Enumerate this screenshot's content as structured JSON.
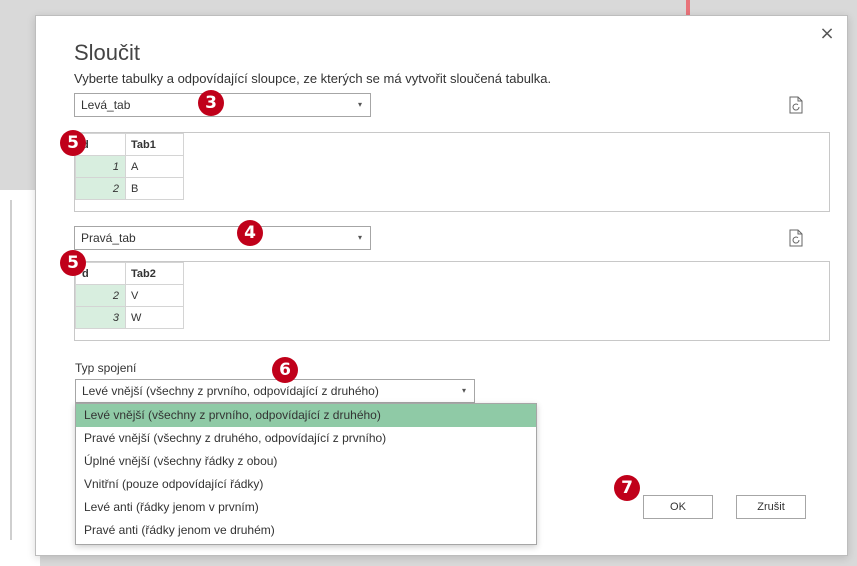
{
  "dialog": {
    "title": "Sloučit",
    "subtitle": "Vyberte tabulky a odpovídající sloupce, ze kterých se má vytvořit sloučená tabulka.",
    "close_icon": "×"
  },
  "left_table": {
    "select_value": "Levá_tab",
    "header": [
      "d",
      "Tab1"
    ],
    "rows": [
      {
        "idx": "1",
        "val": "A"
      },
      {
        "idx": "2",
        "val": "B"
      }
    ]
  },
  "right_table": {
    "select_value": "Pravá_tab",
    "header": [
      "d",
      "Tab2"
    ],
    "rows": [
      {
        "idx": "2",
        "val": "V"
      },
      {
        "idx": "3",
        "val": "W"
      }
    ]
  },
  "join": {
    "label": "Typ spojení",
    "selected": "Levé vnější (všechny z prvního, odpovídající z druhého)",
    "options": [
      "Levé vnější (všechny z prvního, odpovídající z druhého)",
      "Pravé vnější (všechny z druhého, odpovídající z prvního)",
      "Úplné vnější (všechny řádky z obou)",
      "Vnitřní (pouze odpovídající řádky)",
      "Levé anti (řádky jenom v prvním)",
      "Pravé anti (řádky jenom ve druhém)"
    ]
  },
  "buttons": {
    "ok": "OK",
    "cancel": "Zrušit"
  },
  "badges": {
    "b3": "3",
    "b4": "4",
    "b5a": "5",
    "b5b": "5",
    "b6": "6",
    "b7": "7"
  },
  "colors": {
    "badge": "#c0001a",
    "selected_option": "#8fcaa6",
    "index_column": "#d8eedf",
    "arrow": "#e8737a"
  },
  "icons": {
    "caret": "▾",
    "refresh": "refresh-preview-icon"
  }
}
